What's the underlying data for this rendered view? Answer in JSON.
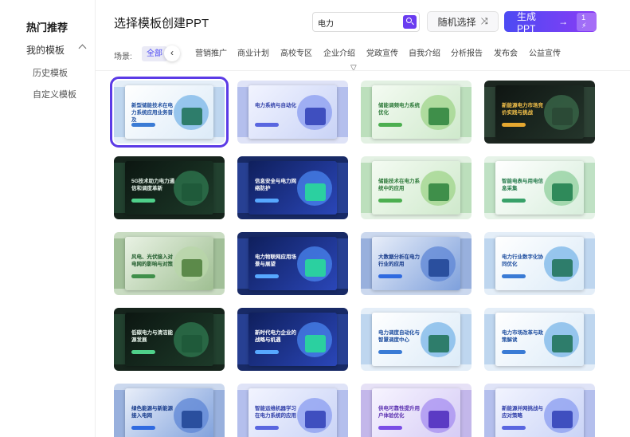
{
  "sidebar": {
    "hot_label": "热门推荐",
    "my_templates_label": "我的模板",
    "sub_items": [
      "历史模板",
      "自定义模板"
    ]
  },
  "header": {
    "page_title": "选择模板创建PPT",
    "search_value": "电力",
    "random_label": "随机选择",
    "generate_label": "生成 PPT",
    "generate_badge": "1 ⚡"
  },
  "filters": {
    "scene_label": "场景:",
    "tags": [
      "全部",
      "营销推广",
      "商业计划",
      "高校专区",
      "企业介绍",
      "党政宣传",
      "自我介绍",
      "分析报告",
      "发布会",
      "公益宣传"
    ],
    "active_index": 0
  },
  "colors": {
    "accent": "#5b3be6",
    "accent_gradient_start": "#4c4af3",
    "accent_gradient_end": "#8a3cf5"
  },
  "cards": [
    {
      "title": "新型储能技术在电力系统应用业务普及",
      "theme": "light-blue",
      "selected": true
    },
    {
      "title": "电力系统与自动化",
      "theme": "blue-purple",
      "selected": false
    },
    {
      "title": "储能调频电力系统优化",
      "theme": "green",
      "selected": false
    },
    {
      "title": "新能源电力市场竞价实践与挑战",
      "theme": "dark",
      "selected": false
    },
    {
      "title": "5G技术助力电力通信和调度革新",
      "theme": "dark-green",
      "selected": false
    },
    {
      "title": "信息安全与电力网络防护",
      "theme": "deep-blue",
      "selected": false
    },
    {
      "title": "储能技术在电力系统中的应用",
      "theme": "green",
      "selected": false
    },
    {
      "title": "智能电表与用电信息采集",
      "theme": "light-green",
      "selected": false
    },
    {
      "title": "风电、光伏接入对电网的影响与对策",
      "theme": "green-photo",
      "selected": false
    },
    {
      "title": "电力物联网应用场景与展望",
      "theme": "deep-blue",
      "selected": false
    },
    {
      "title": "大数据分析在电力行业的应用",
      "theme": "blue-photo",
      "selected": false
    },
    {
      "title": "电力行业数字化协同优化",
      "theme": "light-blue",
      "selected": false
    },
    {
      "title": "低碳电力与清洁能源发展",
      "theme": "dark-green",
      "selected": false
    },
    {
      "title": "新时代电力企业的战略与机遇",
      "theme": "deep-blue",
      "selected": false
    },
    {
      "title": "电力调度自动化与智慧调度中心",
      "theme": "light-blue",
      "selected": false
    },
    {
      "title": "电力市场改革与政策解读",
      "theme": "light-blue",
      "selected": false
    },
    {
      "title": "绿色能源与新能源接入电网",
      "theme": "blue-photo",
      "selected": false
    },
    {
      "title": "智能运维机器学习在电力系统的应用",
      "theme": "blue-purple",
      "selected": false
    },
    {
      "title": "供电可靠性提升用户体验优化",
      "theme": "purple",
      "selected": false
    },
    {
      "title": "新能源并网挑战与应对策略",
      "theme": "blue-purple",
      "selected": false
    }
  ]
}
